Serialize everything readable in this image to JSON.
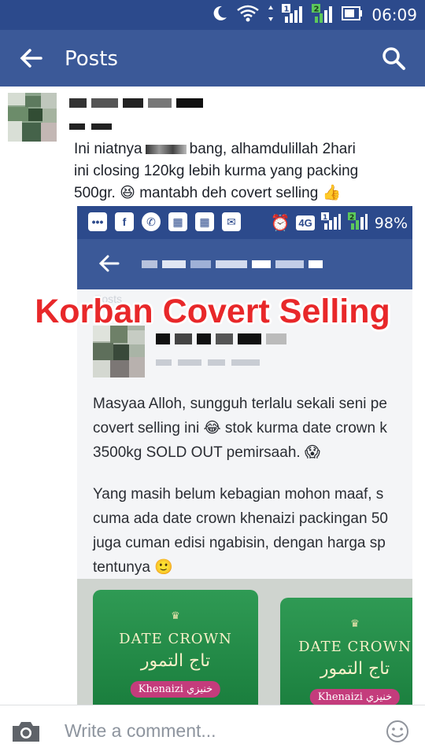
{
  "status_bar": {
    "time": "06:09",
    "sim1": "1",
    "sim2": "2"
  },
  "app_bar": {
    "title": "Posts"
  },
  "post": {
    "text_line1": "Ini niatnya",
    "text_line1b": "bang, alhamdulillah 2hari",
    "text_line2": "ini closing 120kg lebih kurma yang packing",
    "text_line3": "500gr. 😆 mantabh deh covert selling 👍"
  },
  "embedded": {
    "status": {
      "network": "4G",
      "sim1": "1",
      "sim2": "2",
      "battery": "98%"
    },
    "posts_label": "Posts",
    "paragraph1_line1": "Masyaa Alloh, sungguh terlalu sekali seni pe",
    "paragraph1_line2": "covert selling ini 😂 stok kurma date crown k",
    "paragraph1_line3": "3500kg SOLD OUT pemirsaah. 😱",
    "paragraph2_line1": "Yang masih belum kebagian mohon maaf, s",
    "paragraph2_line2": "cuma ada date crown khenaizi packingan 50",
    "paragraph2_line3": "juga cuman edisi ngabisin, dengan harga sp",
    "paragraph2_line4": "tentunya 🙂",
    "bag": {
      "brand": "DATE CROWN",
      "arabic": "تاج التمور",
      "variant": "Khenaizi خنيزي"
    }
  },
  "overlay_caption": "Korban Covert Selling",
  "comment_bar": {
    "placeholder": "Write a comment..."
  },
  "colors": {
    "facebook_blue": "#3b5998",
    "status_blue": "#2c4a8c",
    "overlay_red": "#e8282a"
  },
  "icons": [
    "moon-icon",
    "wifi-icon",
    "signal-icon",
    "battery-icon",
    "back-arrow-icon",
    "search-icon",
    "camera-icon",
    "emoji-icon"
  ]
}
